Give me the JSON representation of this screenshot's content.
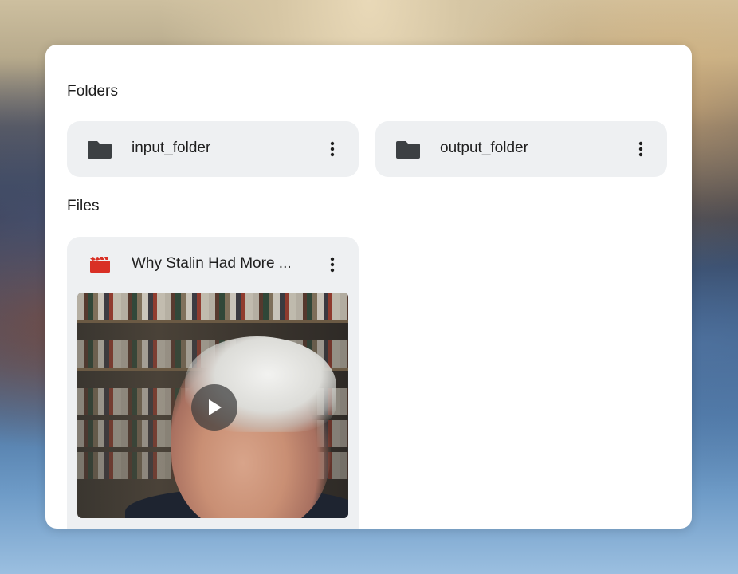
{
  "sections": {
    "folders_title": "Folders",
    "files_title": "Files"
  },
  "folders": [
    {
      "name": "input_folder",
      "icon": "folder-icon"
    },
    {
      "name": "output_folder",
      "icon": "folder-icon"
    }
  ],
  "files": [
    {
      "name": "Why Stalin Had More ...",
      "icon": "video-file-icon",
      "thumbnail": "video-thumbnail"
    }
  ],
  "colors": {
    "folder_icon": "#3c4043",
    "video_icon": "#d93025",
    "card_background": "#eef0f2"
  }
}
